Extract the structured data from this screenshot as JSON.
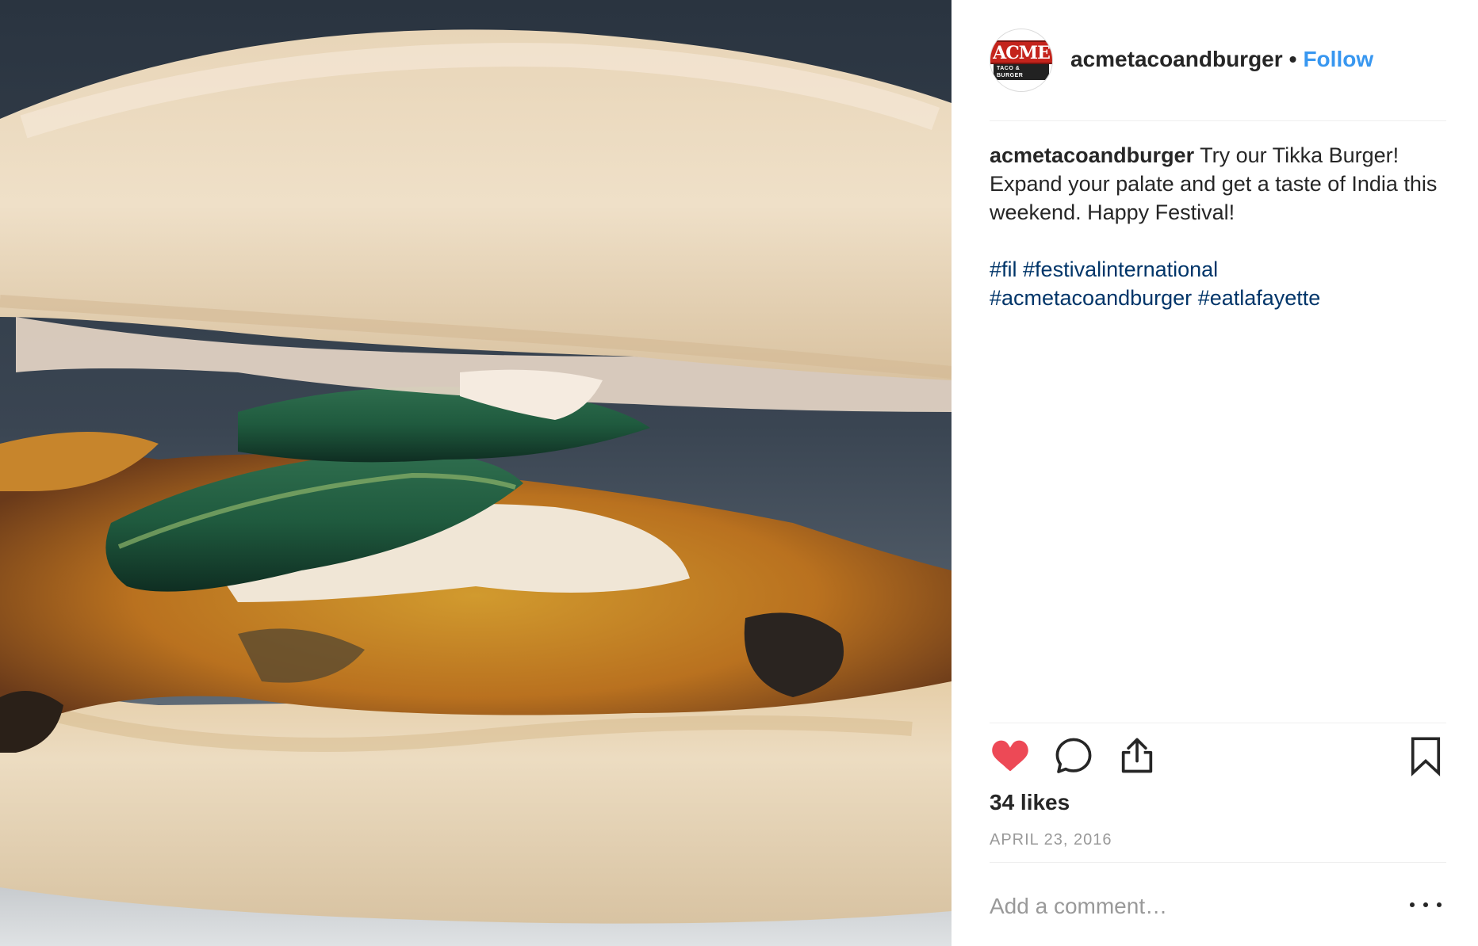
{
  "post": {
    "image_alt": "Tikka burger with zucchini slices",
    "account": {
      "username": "acmetacoandburger",
      "follow_label": "Follow",
      "separator": "•",
      "avatar_logo_main": "ACME",
      "avatar_logo_sub": "TACO & BURGER"
    },
    "caption": {
      "username": "acmetacoandburger",
      "text": "Try our Tikka Burger! Expand your palate and get a taste of India this weekend. Happy Festival!",
      "hashtags": [
        "#fil",
        "#festivalinternational",
        "#acmetacoandburger",
        "#eatlafayette"
      ]
    },
    "actions": {
      "like_icon": "heart-icon",
      "comment_icon": "comment-icon",
      "share_icon": "share-icon",
      "save_icon": "bookmark-icon",
      "liked": true
    },
    "likes_label": "34 likes",
    "date_label": "APRIL 23, 2016",
    "comment_placeholder": "Add a comment…",
    "more_icon": "ellipsis-icon"
  },
  "colors": {
    "like": "#ed4956",
    "follow": "#3897f0",
    "hashtag": "#003569",
    "muted": "#999999",
    "text": "#262626"
  }
}
